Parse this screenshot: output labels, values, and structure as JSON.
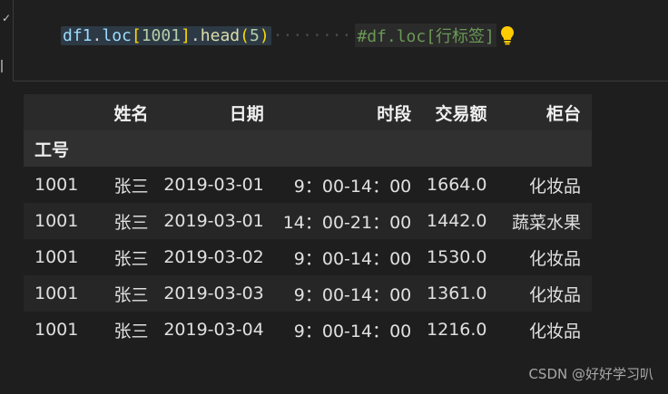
{
  "code": {
    "var": "df1",
    "dot1": ".",
    "attr": "loc",
    "br_open": "[",
    "index": "1001",
    "br_close": "]",
    "dot2": ".",
    "fn": "head",
    "paren_open": "(",
    "arg": "5",
    "paren_close": ")",
    "comment": "#df.loc[行标签]"
  },
  "table": {
    "columns": [
      "姓名",
      "日期",
      "时段",
      "交易额",
      "柜台"
    ],
    "index_name": "工号",
    "rows": [
      [
        "1001",
        "张三",
        "2019-03-01",
        "9：00-14：00",
        "1664.0",
        "化妆品"
      ],
      [
        "1001",
        "张三",
        "2019-03-01",
        "14：00-21：00",
        "1442.0",
        "蔬菜水果"
      ],
      [
        "1001",
        "张三",
        "2019-03-02",
        "9：00-14：00",
        "1530.0",
        "化妆品"
      ],
      [
        "1001",
        "张三",
        "2019-03-03",
        "9：00-14：00",
        "1361.0",
        "化妆品"
      ],
      [
        "1001",
        "张三",
        "2019-03-04",
        "9：00-14：00",
        "1216.0",
        "化妆品"
      ]
    ]
  },
  "watermark": "CSDN @好好学习叭",
  "icons": {
    "gutter": "chevron-down-icon",
    "lightbulb": "lightbulb-icon"
  },
  "colors": {
    "background": "#1e1e1e",
    "bulb": "#ffcc00"
  }
}
